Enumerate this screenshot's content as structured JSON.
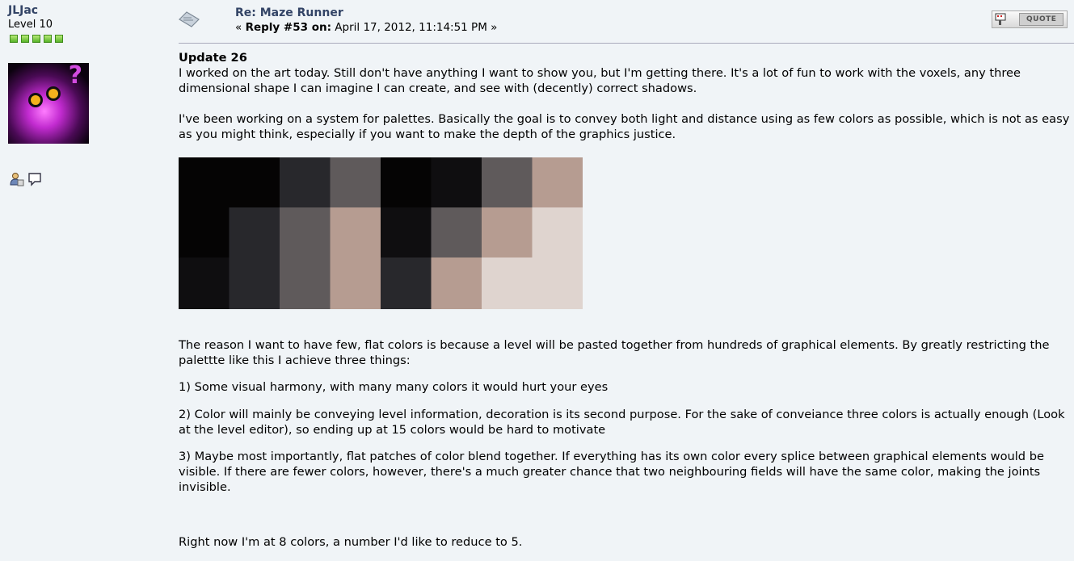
{
  "poster": {
    "name": "JLJac",
    "level": "Level 10",
    "stars": 5
  },
  "post": {
    "subject": "Re: Maze Runner",
    "reply_prefix": "« ",
    "reply_label": "Reply #53 on:",
    "reply_date": " April 17, 2012, 11:14:51 PM »",
    "quote_label": "QUOTE",
    "heading": "Update 26",
    "para1": "I worked on the art today. Still don't have anything I want to show you, but I'm getting there. It's a lot of fun to work with the voxels, any three dimensional shape I can imagine I can create, and see with (decently) correct shadows.",
    "para2": "I've been working on a system for palettes. Basically the goal is to convey both light and distance using as few colors as possible, which is not as easy as you might think, especially if you want to make the depth of the graphics justice.",
    "para3": "The reason I want to have few, flat colors is because a level will be pasted together from hundreds of graphical elements. By greatly restricting the palettte like this I achieve three things:",
    "item1": "1) Some visual harmony, with many many colors it would hurt your eyes",
    "item2": "2) Color will mainly be conveying level information, decoration is its second purpose. For the sake of conveiance three colors is actually enough (Look at the level editor), so ending up at 15 colors would be hard to motivate",
    "item3": "3) Maybe most importantly, flat patches of color blend together. If everything has its own color every splice between graphical elements would be visible. If there are fewer colors, however, there's a much greater chance that two neighbouring fields will have the same color, making the joints invisible.",
    "para4": "Right now I'm at 8 colors, a number I'd like to reduce to 5."
  },
  "palette_image": {
    "rows": [
      [
        "#050404",
        "#050404",
        "#28282c",
        "#5f5a5b",
        "#050404",
        "#0f0e10",
        "#5f5a5b",
        "#b69c91"
      ],
      [
        "#050404",
        "#28282c",
        "#5f5a5b",
        "#b69c91",
        "#0f0e10",
        "#5f5a5b",
        "#b69c91",
        "#dfd4cf"
      ],
      [
        "#0f0e10",
        "#28282c",
        "#5f5a5b",
        "#b69c91",
        "#28282c",
        "#b69c91",
        "#dfd4cf",
        "#dfd4cf"
      ]
    ]
  },
  "colors": {
    "link": "#334466",
    "background": "#f0f4f7"
  },
  "icons": {
    "topic": "topic-icon",
    "profile": "profile-icon",
    "pm": "message-icon",
    "quote": "quote-icon"
  }
}
